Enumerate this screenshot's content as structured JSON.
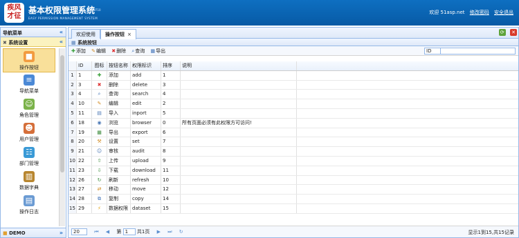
{
  "header": {
    "logo_text": "疾风 才征",
    "title": "基本权限管理系统",
    "version": "v0710",
    "subtitle": "EASY PERMISSION MANAGEMENT SYSTEM",
    "welcome": "欢迎 51asp.net",
    "change_pwd": "修改密码",
    "logout": "安全退出"
  },
  "sidebar": {
    "title": "导航菜单",
    "section": "系统设置",
    "bottom_section": "DEMO",
    "items": [
      {
        "label": "操作按钮",
        "icon": "cubes-icon"
      },
      {
        "label": "导航菜单",
        "icon": "menu-icon"
      },
      {
        "label": "角色管理",
        "icon": "role-icon"
      },
      {
        "label": "用户管理",
        "icon": "users-icon"
      },
      {
        "label": "部门管理",
        "icon": "dept-icon"
      },
      {
        "label": "数据字典",
        "icon": "book-icon"
      },
      {
        "label": "操作日志",
        "icon": "log-icon"
      }
    ]
  },
  "tabs": [
    {
      "label": "欢迎使用"
    },
    {
      "label": "操作按钮"
    }
  ],
  "panel_title": "系统按钮",
  "toolbar": {
    "add": "添加",
    "edit": "编辑",
    "delete": "删除",
    "search": "查询",
    "export": "导出"
  },
  "search": {
    "field": "ID",
    "placeholder": ""
  },
  "columns": [
    "ID",
    "图标",
    "按钮名称",
    "权限标识",
    "排序",
    "说明"
  ],
  "rows": [
    {
      "n": "1",
      "id": "1",
      "icon": "✚",
      "name": "添加",
      "code": "add",
      "sort": "1",
      "desc": ""
    },
    {
      "n": "2",
      "id": "3",
      "icon": "✖",
      "name": "删除",
      "code": "delete",
      "sort": "3",
      "desc": ""
    },
    {
      "n": "3",
      "id": "4",
      "icon": "⌕",
      "name": "查询",
      "code": "search",
      "sort": "4",
      "desc": ""
    },
    {
      "n": "4",
      "id": "10",
      "icon": "✎",
      "name": "编辑",
      "code": "edit",
      "sort": "2",
      "desc": ""
    },
    {
      "n": "5",
      "id": "11",
      "icon": "▤",
      "name": "导入",
      "code": "inport",
      "sort": "5",
      "desc": ""
    },
    {
      "n": "6",
      "id": "18",
      "icon": "◉",
      "name": "浏览",
      "code": "browser",
      "sort": "0",
      "desc": "所有页面必须有此权限方可访问!"
    },
    {
      "n": "7",
      "id": "19",
      "icon": "▦",
      "name": "导出",
      "code": "export",
      "sort": "6",
      "desc": ""
    },
    {
      "n": "8",
      "id": "20",
      "icon": "⚒",
      "name": "设置",
      "code": "set",
      "sort": "7",
      "desc": ""
    },
    {
      "n": "9",
      "id": "21",
      "icon": "☺",
      "name": "审核",
      "code": "audit",
      "sort": "8",
      "desc": ""
    },
    {
      "n": "10",
      "id": "22",
      "icon": "⇧",
      "name": "上传",
      "code": "upload",
      "sort": "9",
      "desc": ""
    },
    {
      "n": "11",
      "id": "23",
      "icon": "⇩",
      "name": "下载",
      "code": "download",
      "sort": "11",
      "desc": ""
    },
    {
      "n": "12",
      "id": "26",
      "icon": "↻",
      "name": "刷新",
      "code": "refresh",
      "sort": "10",
      "desc": ""
    },
    {
      "n": "13",
      "id": "27",
      "icon": "⇄",
      "name": "移动",
      "code": "move",
      "sort": "12",
      "desc": ""
    },
    {
      "n": "14",
      "id": "28",
      "icon": "⧉",
      "name": "复制",
      "code": "copy",
      "sort": "14",
      "desc": ""
    },
    {
      "n": "15",
      "id": "29",
      "icon": "⚡",
      "name": "数据权限",
      "code": "dataset",
      "sort": "15",
      "desc": ""
    }
  ],
  "pager": {
    "page_size": "20",
    "page_label": "第",
    "page": "1",
    "total_pages": "共1页",
    "info": "显示1到15,共15记录"
  },
  "colors": {
    "brand": "#0a63b4",
    "accent": "#95b8e7",
    "active": "#f9e09a"
  }
}
